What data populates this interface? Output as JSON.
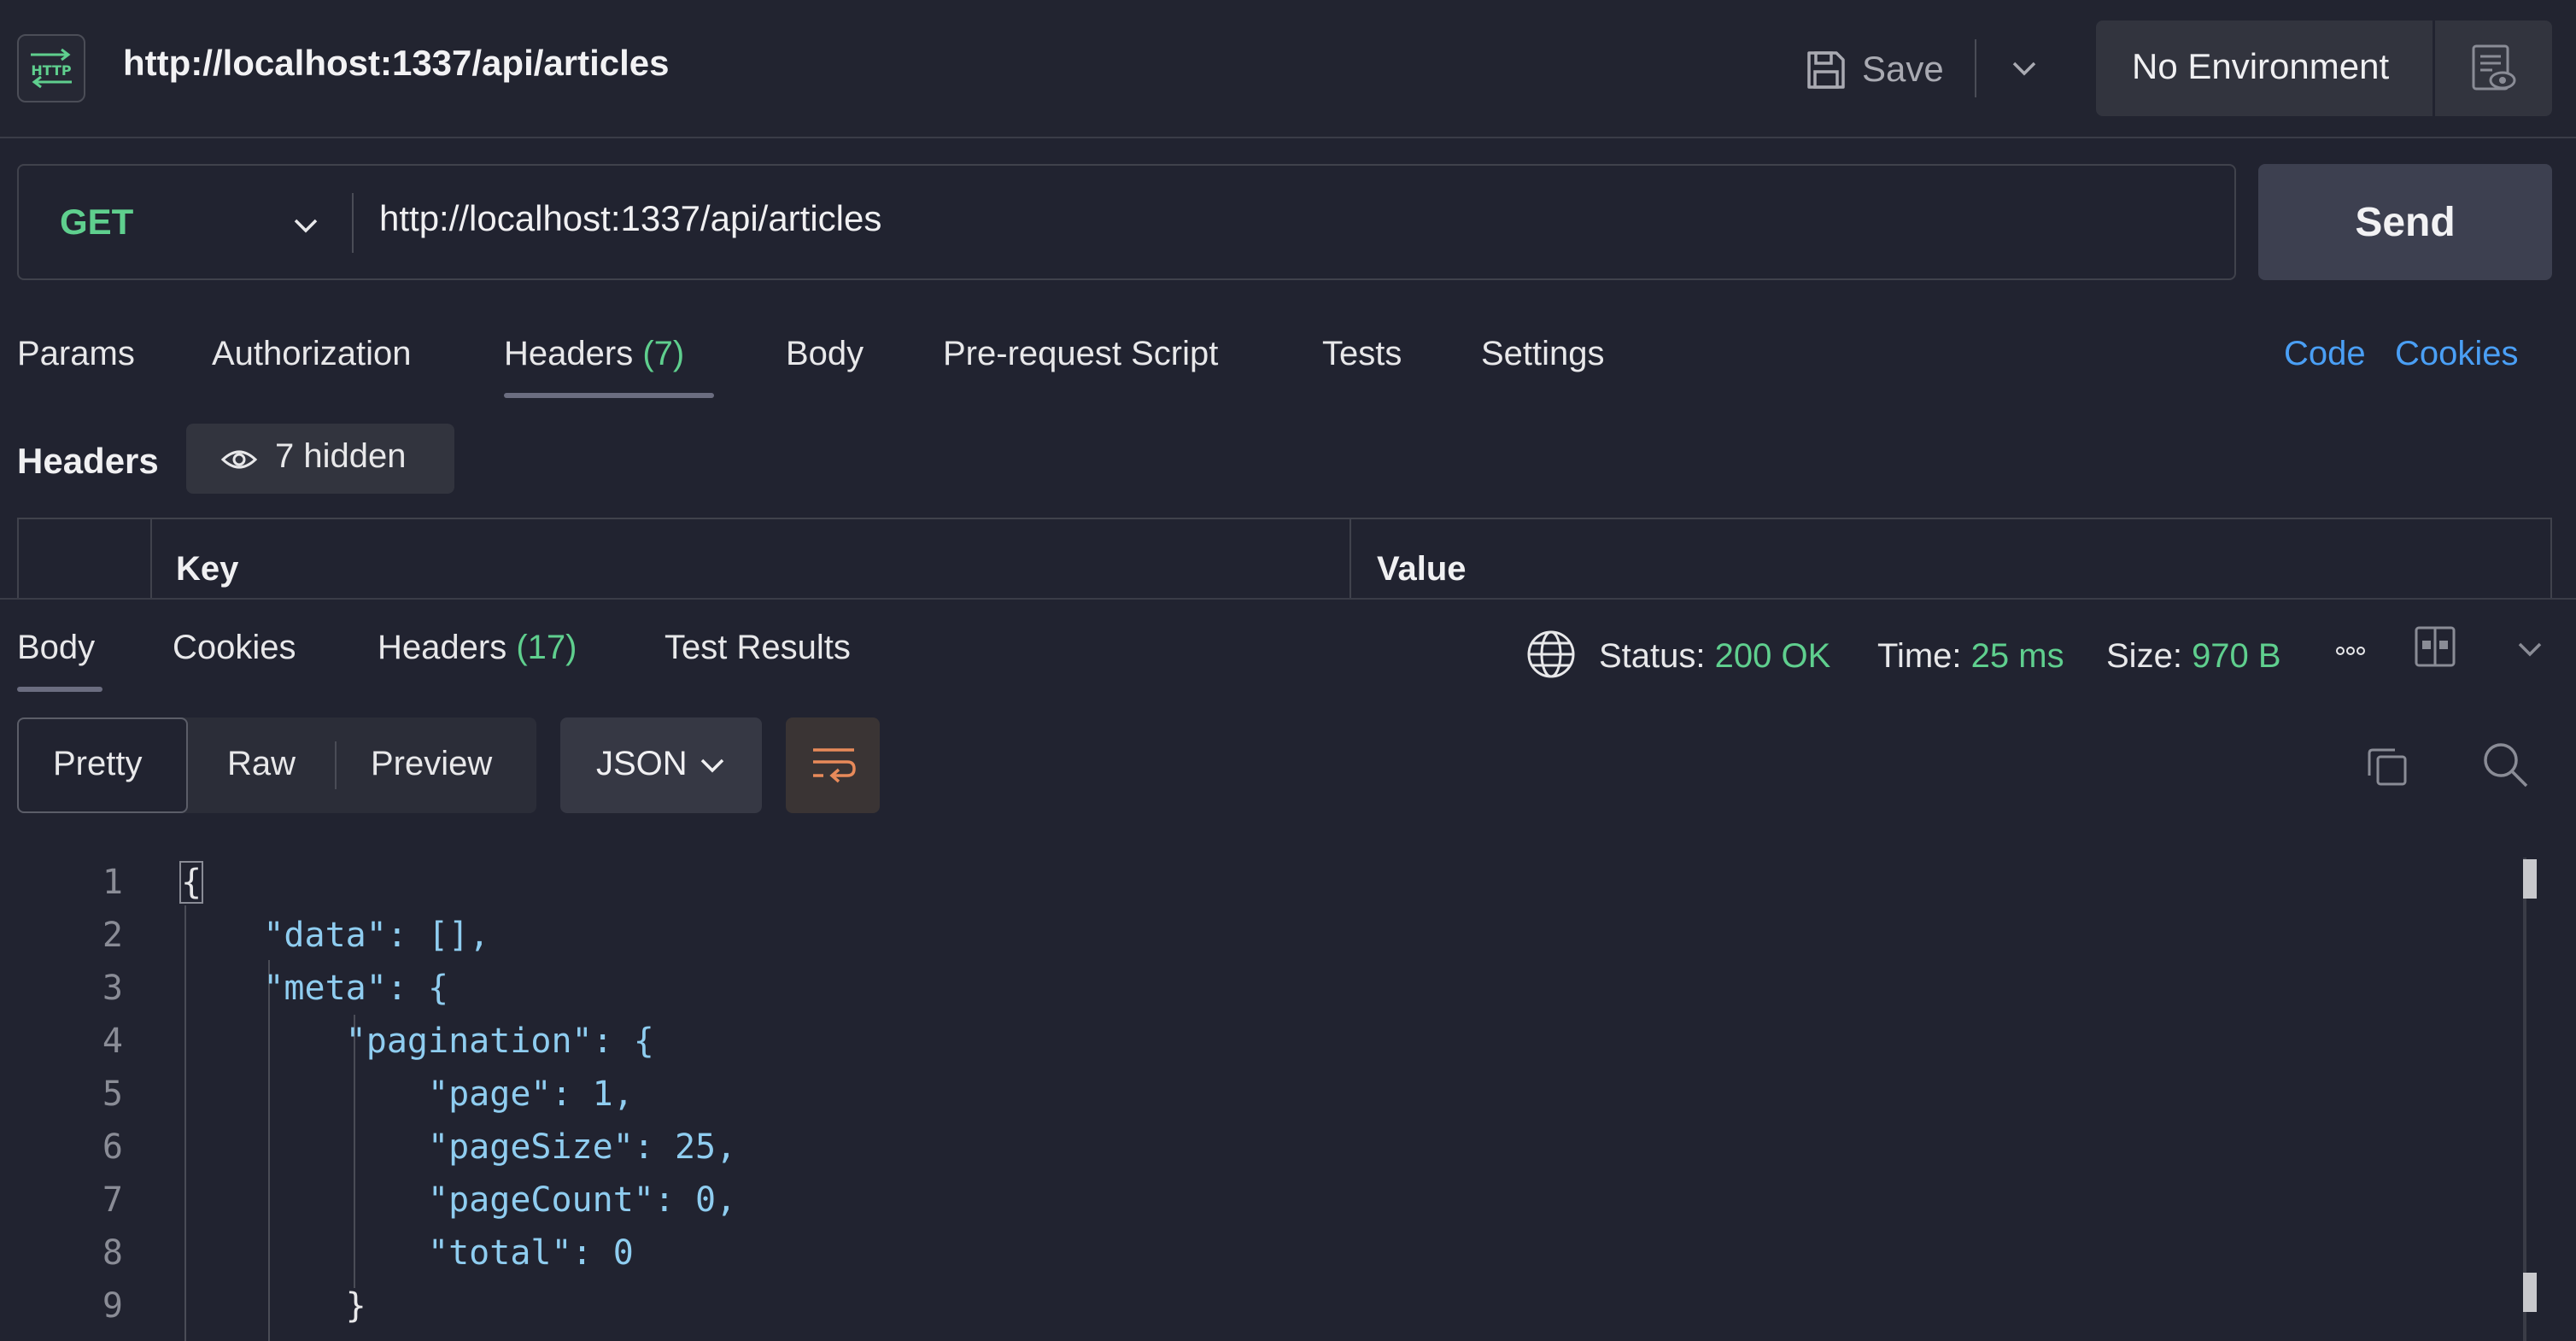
{
  "header": {
    "title": "http://localhost:1337/api/articles",
    "save_label": "Save",
    "environment": "No Environment"
  },
  "request": {
    "method": "GET",
    "url": "http://localhost:1337/api/articles",
    "send_label": "Send"
  },
  "request_tabs": [
    {
      "label": "Params"
    },
    {
      "label": "Authorization"
    },
    {
      "label": "Headers",
      "count": "(7)",
      "active": true
    },
    {
      "label": "Body"
    },
    {
      "label": "Pre-request Script"
    },
    {
      "label": "Tests"
    },
    {
      "label": "Settings"
    }
  ],
  "request_links": {
    "code": "Code",
    "cookies": "Cookies"
  },
  "headers_section": {
    "title": "Headers",
    "hidden_label": "7 hidden",
    "col_key": "Key",
    "col_value": "Value"
  },
  "response_tabs": [
    {
      "label": "Body",
      "active": true
    },
    {
      "label": "Cookies"
    },
    {
      "label": "Headers",
      "count": "(17)"
    },
    {
      "label": "Test Results"
    }
  ],
  "status": {
    "status_label": "Status:",
    "status_value": "200 OK",
    "time_label": "Time:",
    "time_value": "25 ms",
    "size_label": "Size:",
    "size_value": "970 B"
  },
  "view_modes": [
    "Pretty",
    "Raw",
    "Preview"
  ],
  "format": "JSON",
  "code_lines": [
    {
      "n": "1",
      "text": "{"
    },
    {
      "n": "2",
      "text": "    \"data\": [],"
    },
    {
      "n": "3",
      "text": "    \"meta\": {"
    },
    {
      "n": "4",
      "text": "        \"pagination\": {"
    },
    {
      "n": "5",
      "text": "            \"page\": 1,"
    },
    {
      "n": "6",
      "text": "            \"pageSize\": 25,"
    },
    {
      "n": "7",
      "text": "            \"pageCount\": 0,"
    },
    {
      "n": "8",
      "text": "            \"total\": 0"
    },
    {
      "n": "9",
      "text": "        }"
    }
  ],
  "colors": {
    "accent_green": "#5fcf8e",
    "link_blue": "#4a9ff5",
    "wrap_orange": "#e88a5a"
  },
  "icons": [
    "http-icon",
    "save-icon",
    "chevron-down-icon",
    "environment-eye-icon",
    "eye-icon",
    "globe-icon",
    "more-icon",
    "layout-icon",
    "wrap-lines-icon",
    "copy-icon",
    "search-icon"
  ]
}
